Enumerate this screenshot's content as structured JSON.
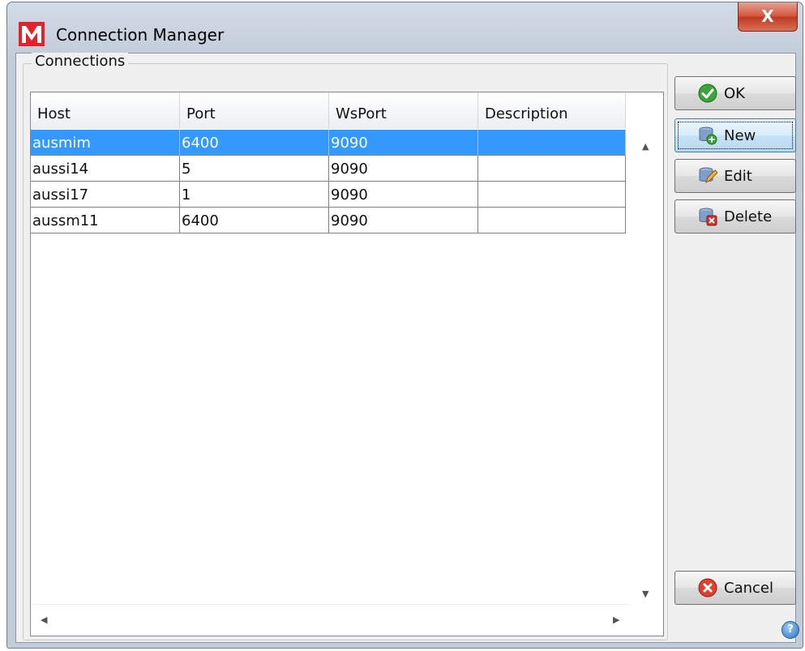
{
  "window": {
    "title": "Connection Manager",
    "close_glyph": "X"
  },
  "group": {
    "label": "Connections"
  },
  "table": {
    "columns": [
      "Host",
      "Port",
      "WsPort",
      "Description"
    ],
    "rows": [
      {
        "host": "ausmim",
        "port": "6400",
        "wsport": "9090",
        "description": ""
      },
      {
        "host": "aussi14",
        "port": "5",
        "wsport": "9090",
        "description": ""
      },
      {
        "host": "aussi17",
        "port": "1",
        "wsport": "9090",
        "description": ""
      },
      {
        "host": "aussm11",
        "port": "6400",
        "wsport": "9090",
        "description": ""
      }
    ],
    "selected_row": 0
  },
  "buttons": {
    "ok": "OK",
    "new": "New",
    "edit": "Edit",
    "delete": "Delete",
    "cancel": "Cancel"
  },
  "help": {
    "glyph": "?"
  },
  "colors": {
    "selection": "#3399ff",
    "accent": "#d2533a"
  },
  "icons": {
    "app": "app-logo-icon",
    "ok": "check-circle-icon",
    "new": "database-add-icon",
    "edit": "database-edit-icon",
    "delete": "database-delete-icon",
    "cancel": "cancel-circle-icon",
    "help": "help-icon"
  }
}
